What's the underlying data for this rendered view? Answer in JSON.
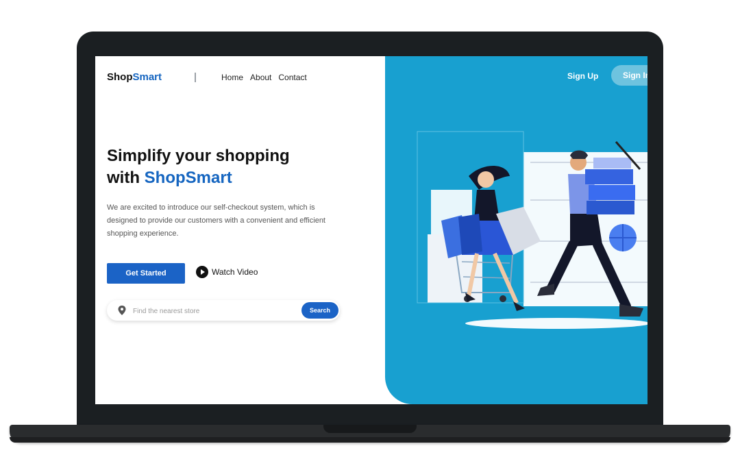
{
  "brand": {
    "part1": "Shop",
    "part2": "Smart"
  },
  "nav": {
    "links": [
      "Home",
      "About",
      "Contact"
    ]
  },
  "auth": {
    "sign_up": "Sign Up",
    "sign_in": "Sign In"
  },
  "hero": {
    "title_line1": "Simplify your shopping",
    "title_prefix": "with",
    "title_accent": "ShopSmart",
    "description": "We are excited to introduce our self-checkout system, which is designed to provide our customers with a convenient and efficient shopping experience.",
    "primary_button": "Get Started",
    "secondary_button": "Watch Video"
  },
  "search": {
    "placeholder": "Find the nearest store",
    "button": "Search"
  },
  "icons": {
    "watch": "play-icon",
    "search": "location-pin-icon"
  },
  "colors": {
    "accent": "#1565c0",
    "panel": "#18a0d0",
    "button": "#1b63c6"
  }
}
